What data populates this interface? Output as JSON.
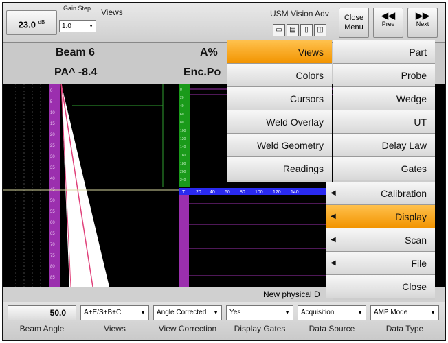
{
  "toolbar": {
    "gain_value": "23.0",
    "gain_unit": "dB",
    "gain_step_label": "Gain Step",
    "gain_step_value": "1.0",
    "views_label": "Views",
    "usm_label": "USM Vision Adv",
    "close_menu_label": "Close Menu",
    "prev_label": "Prev",
    "next_label": "Next"
  },
  "header": {
    "beam_label": "Beam 6",
    "pa_label": "PA^ -8.4",
    "amp_label": "A%",
    "enc_label": "Enc.Po"
  },
  "status": {
    "text": "New physical D"
  },
  "scale": {
    "ticks_top": [
      "T",
      "20",
      "40",
      "60",
      "80",
      "100",
      "120",
      "140"
    ],
    "ticks_left": [
      "0",
      "5",
      "10",
      "15",
      "20",
      "25",
      "30",
      "35",
      "40",
      "45",
      "50",
      "55",
      "60",
      "65",
      "70",
      "75",
      "80",
      "85"
    ]
  },
  "params": [
    {
      "label": "Beam Angle",
      "value": "50.0"
    },
    {
      "label": "Views",
      "value": "A+E/S+B+C"
    },
    {
      "label": "View Correction",
      "value": "Angle Corrected"
    },
    {
      "label": "Display Gates",
      "value": "Yes"
    },
    {
      "label": "Data Source",
      "value": "Acquisition"
    },
    {
      "label": "Data Type",
      "value": "AMP Mode"
    }
  ],
  "submenu_views": [
    "Views",
    "Colors",
    "Cursors",
    "Weld Overlay",
    "Weld Geometry",
    "Readings"
  ],
  "main_menu": [
    "Part",
    "Probe",
    "Wedge",
    "UT",
    "Delay Law",
    "Gates",
    "Calibration",
    "Display",
    "Scan",
    "File",
    "Close"
  ],
  "colors": {
    "highlight": "#f29400",
    "scale_purple": "#9b2fae",
    "scale_green": "#1a9a1a",
    "trace_pink": "#e0407a"
  }
}
